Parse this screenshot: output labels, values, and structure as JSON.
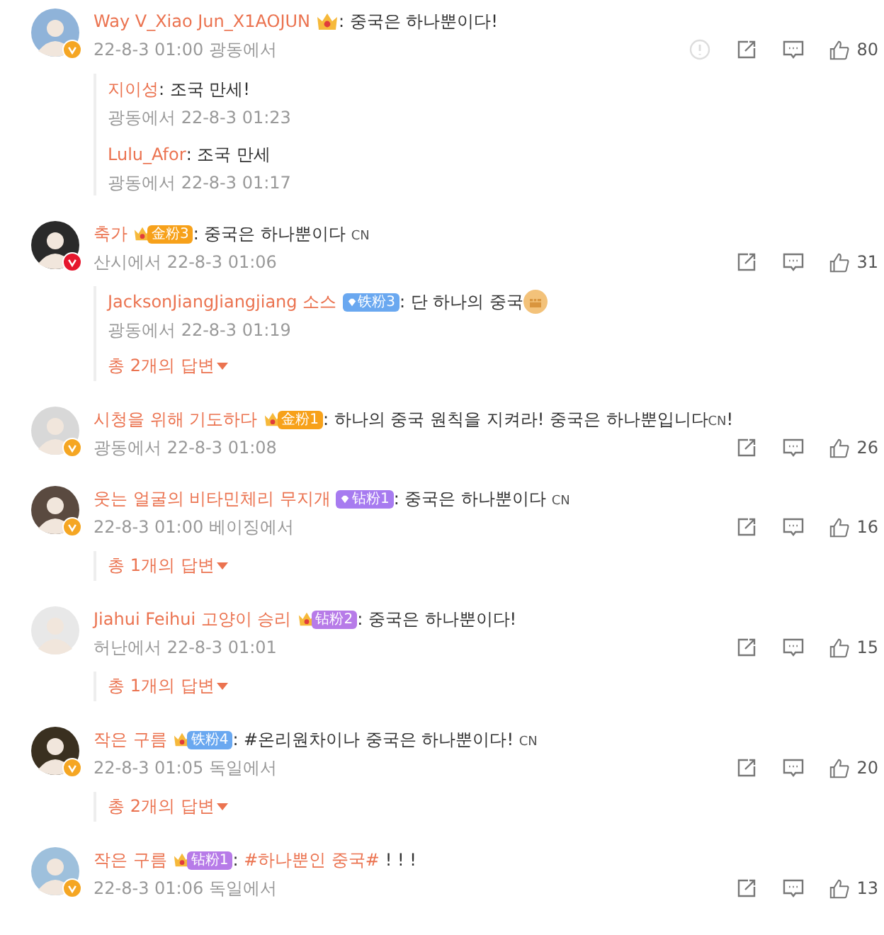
{
  "comments": [
    {
      "name": "Way V_Xiao Jun_X1AOJUN",
      "badge": {
        "kind": "crown"
      },
      "content": [
        {
          "kind": "plain",
          "text": ": 중국은 하나뿐이다!"
        }
      ],
      "meta": "22-8-3 01:00 광동에서",
      "verified": {
        "color": "#f5a623"
      },
      "hovered": true,
      "likes": "80",
      "replies": [
        {
          "name": "지이성",
          "content": [
            {
              "kind": "plain",
              "text": ": 조국 만세!"
            }
          ],
          "meta": "광동에서 22-8-3 01:23"
        },
        {
          "name": "Lulu_Afor",
          "content": [
            {
              "kind": "plain",
              "text": ": 조국 만세"
            }
          ],
          "meta": "광동에서 22-8-3 01:17"
        }
      ]
    },
    {
      "name": "축가",
      "badge": {
        "kind": "crown-label",
        "label": "金粉3",
        "color": "#f7a11a"
      },
      "content": [
        {
          "kind": "plain",
          "text": ": 중국은 하나뿐이다 "
        },
        {
          "kind": "cn",
          "text": "CN"
        }
      ],
      "meta": "산시에서 22-8-3 01:06",
      "verified": {
        "color": "#e6162d"
      },
      "hovered": false,
      "likes": "31",
      "replies": [
        {
          "name": "JacksonJiangJiangjiang 소스",
          "badge": {
            "kind": "diamond-label",
            "label": "铁粉3",
            "color": "#6aa8f0"
          },
          "content": [
            {
              "kind": "plain",
              "text": ": 단 하나의 중국"
            },
            {
              "kind": "fist"
            }
          ],
          "meta": "광동에서 22-8-3 01:19"
        }
      ],
      "more": "총 2개의 답변"
    },
    {
      "name": "시청을 위해 기도하다",
      "badge": {
        "kind": "crown-label",
        "label": "金粉1",
        "color": "#f7a11a"
      },
      "content": [
        {
          "kind": "plain",
          "text": ": 하나의 중국 원칙을 지켜라! 중국은 하나뿐입니다"
        },
        {
          "kind": "cn",
          "text": "CN"
        },
        {
          "kind": "plain",
          "text": "!"
        }
      ],
      "meta": "광동에서 22-8-3 01:08",
      "verified": {
        "color": "#f5a623"
      },
      "hovered": false,
      "likes": "26"
    },
    {
      "name": "웃는 얼굴의 비타민체리 무지개",
      "badge": {
        "kind": "diamond-label",
        "label": "钻粉1",
        "color": "#a77bf0"
      },
      "content": [
        {
          "kind": "plain",
          "text": ": 중국은 하나뿐이다 "
        },
        {
          "kind": "cn",
          "text": "CN"
        }
      ],
      "meta": "22-8-3 01:00 베이징에서",
      "verified": {
        "color": "#f5a623"
      },
      "hovered": false,
      "likes": "16",
      "more": "총 1개의 답변"
    },
    {
      "name": "Jiahui Feihui 고양이 승리",
      "badge": {
        "kind": "crown-label",
        "label": "钻粉2",
        "color": "#b77be8"
      },
      "content": [
        {
          "kind": "plain",
          "text": ": 중국은 하나뿐이다!"
        }
      ],
      "meta": "허난에서 22-8-3 01:01",
      "hovered": false,
      "likes": "15",
      "more": "총 1개의 답변"
    },
    {
      "name": "작은 구름",
      "badge": {
        "kind": "crown-label",
        "label": "铁粉4",
        "color": "#6aa8f0"
      },
      "content": [
        {
          "kind": "plain",
          "text": ": #온리원차이나 중국은 하나뿐이다! "
        },
        {
          "kind": "cn",
          "text": "CN"
        }
      ],
      "meta": "22-8-3 01:05 독일에서",
      "verified": {
        "color": "#f5a623"
      },
      "hovered": false,
      "likes": "20",
      "more": "총 2개의 답변"
    },
    {
      "name": "작은 구름",
      "badge": {
        "kind": "crown-label",
        "label": "钻粉1",
        "color": "#b77be8"
      },
      "content": [
        {
          "kind": "plain",
          "text": ": "
        },
        {
          "kind": "hashtag",
          "text": "#하나뿐인 중국#"
        },
        {
          "kind": "plain",
          "text": " ! ! !"
        }
      ],
      "meta": "22-8-3 01:06 독일에서",
      "verified": {
        "color": "#f5a623"
      },
      "hovered": false,
      "likes": "13"
    }
  ]
}
